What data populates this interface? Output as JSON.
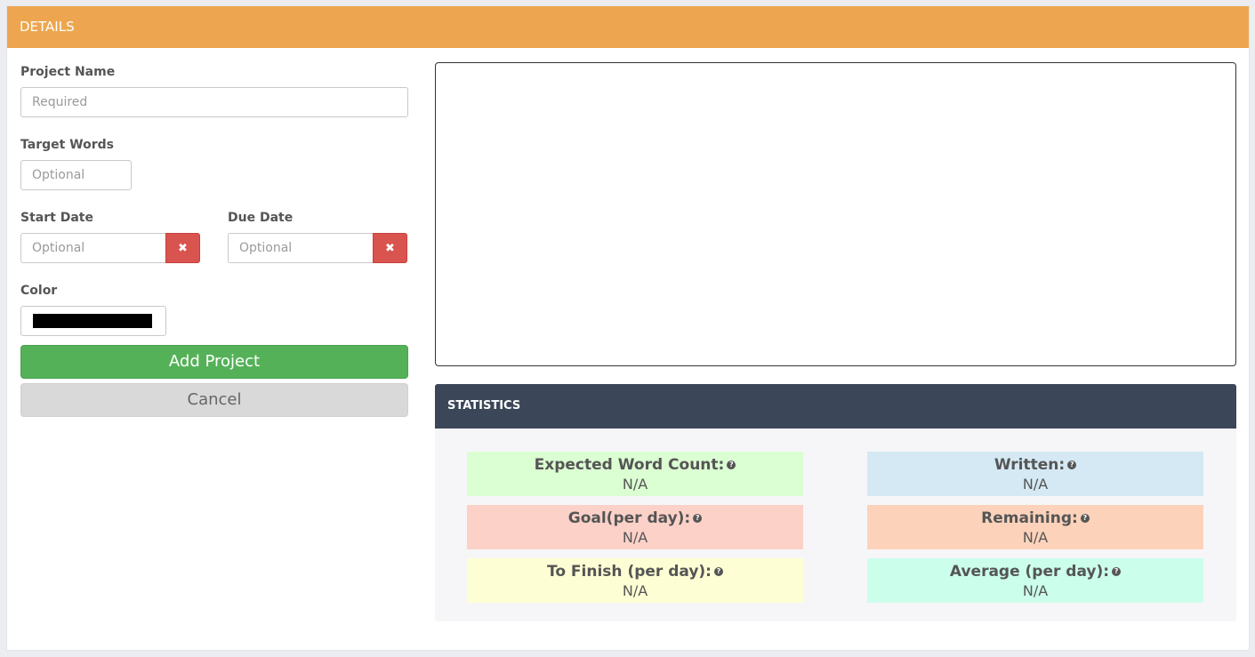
{
  "header": {
    "title": "DETAILS"
  },
  "form": {
    "project_name": {
      "label": "Project Name",
      "placeholder": "Required"
    },
    "target_words": {
      "label": "Target Words",
      "placeholder": "Optional"
    },
    "start_date": {
      "label": "Start Date",
      "placeholder": "Optional",
      "clear_icon": "✖"
    },
    "due_date": {
      "label": "Due Date",
      "placeholder": "Optional",
      "clear_icon": "✖"
    },
    "color": {
      "label": "Color",
      "value": "#000000"
    },
    "add_label": "Add Project",
    "cancel_label": "Cancel"
  },
  "statistics": {
    "title": "STATISTICS",
    "items": [
      {
        "label": "Expected Word Count:",
        "value": "N/A",
        "bg": "#dbfed2"
      },
      {
        "label": "Written:",
        "value": "N/A",
        "bg": "#d4e9f4"
      },
      {
        "label": "Goal(per day):",
        "value": "N/A",
        "bg": "#fcd1c8"
      },
      {
        "label": "Remaining:",
        "value": "N/A",
        "bg": "#fdd2bb"
      },
      {
        "label": "To Finish (per day):",
        "value": "N/A",
        "bg": "#fefed4"
      },
      {
        "label": "Average (per day):",
        "value": "N/A",
        "bg": "#cbfeeb"
      }
    ]
  },
  "colors": {
    "header": "#eda64f",
    "stats_header": "#3b4658",
    "add_button": "#55b158",
    "clear_button": "#d9534f"
  }
}
